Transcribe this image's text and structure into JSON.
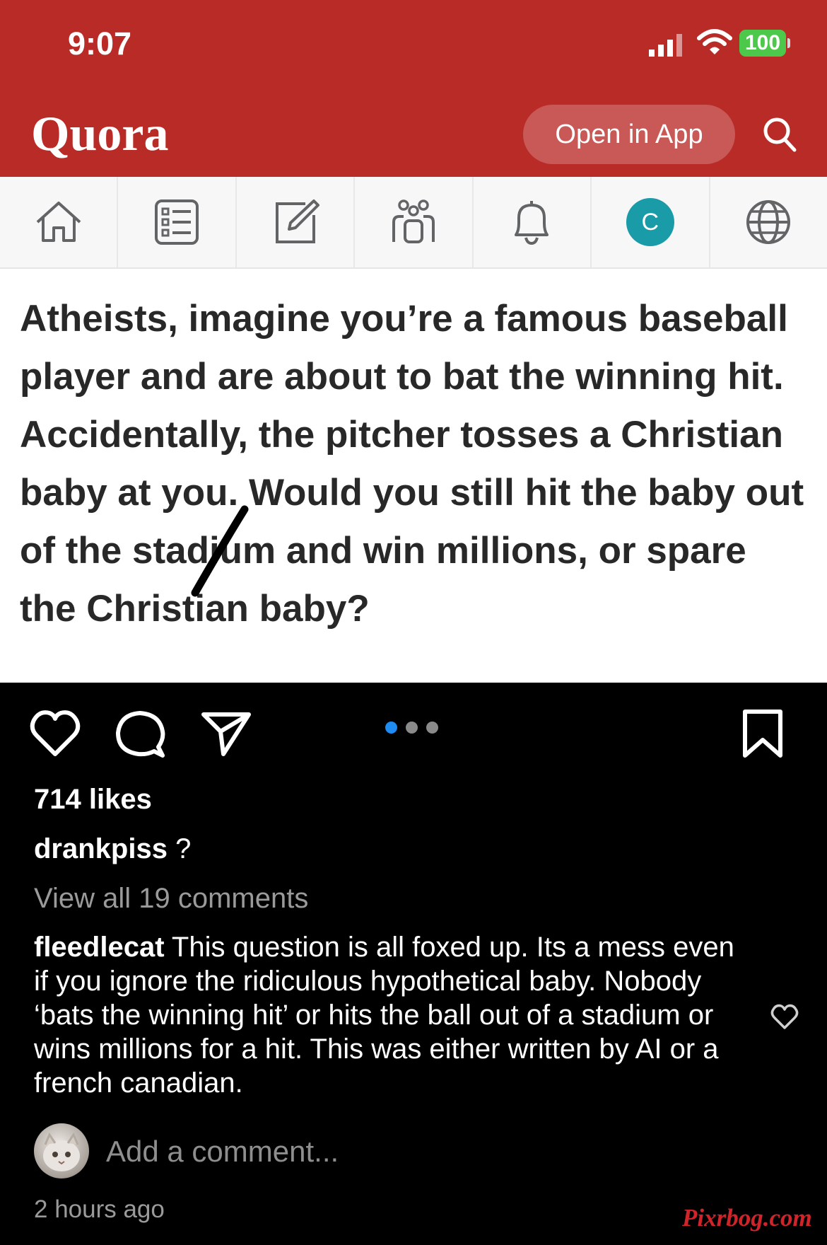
{
  "status_bar": {
    "time": "9:07",
    "battery": "100"
  },
  "quora": {
    "logo": "Quora",
    "open_in_app": "Open in App",
    "nav": {
      "icons": [
        "home-icon",
        "answer-list-icon",
        "write-icon",
        "spaces-icon",
        "bell-icon",
        "profile-avatar",
        "globe-icon"
      ],
      "avatar_letter": "C"
    },
    "question": "Atheists, imagine you’re a famous baseball player and are about to bat the winning hit. Accidentally, the pitcher tosses a Christian baby at you. Would you still hit the baby out of the stadium and win millions, or spare the Christian baby?",
    "colors": {
      "brand_red": "#b92b27",
      "avatar_teal": "#1a9ba8"
    }
  },
  "instagram": {
    "likes": "714 likes",
    "caption_user": "drankpiss",
    "caption_text": " ?",
    "view_all": "View all 19 comments",
    "comment_user": "fleedlecat",
    "comment_text": " This question is all foxed up. Its a mess even if you ignore the ridiculous hypothetical baby. Nobody ‘bats the winning hit’ or hits the ball out of a stadium or wins millions for a hit.  This was either written by AI or a french canadian.",
    "add_comment_placeholder": "Add a comment...",
    "time_ago": "2 hours ago",
    "carousel": {
      "count": 3,
      "active_index": 0
    },
    "colors": {
      "active_dot": "#1e8cf0"
    }
  },
  "watermark": "Pixrbog.com"
}
